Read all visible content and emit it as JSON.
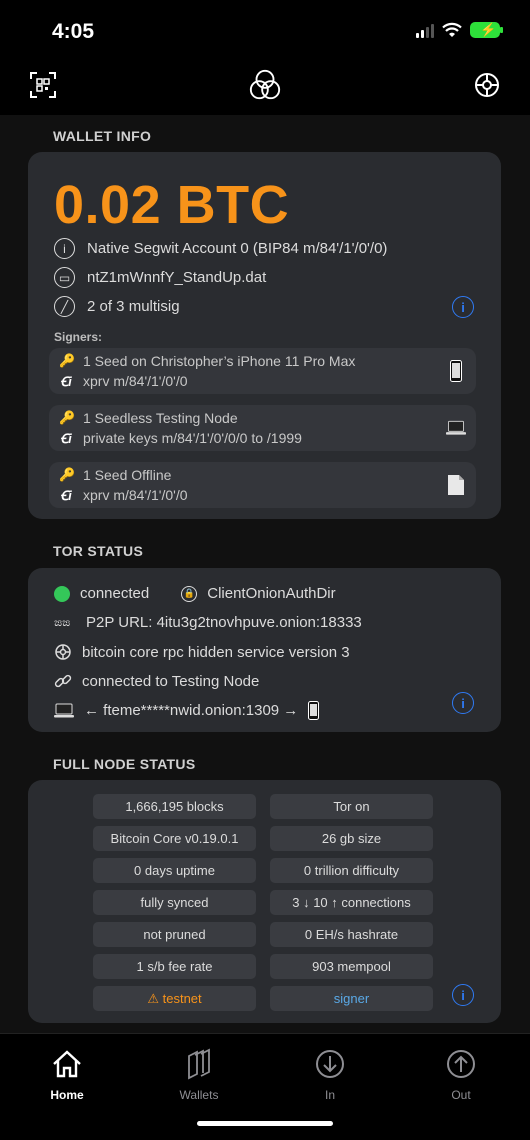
{
  "status_bar": {
    "time": "4:05"
  },
  "wallet_info": {
    "section_title": "WALLET INFO",
    "balance": "0.02 BTC",
    "account": "Native Segwit Account 0 (BIP84 m/84'/1'/0'/0)",
    "filename": "ntZ1mWnnfY_StandUp.dat",
    "multisig": "2 of 3 multisig",
    "signers_label": "Signers:",
    "signers": [
      {
        "title": "1 Seed on Christopher’s iPhone 11 Pro Max",
        "detail": "xprv m/84'/1'/0'/0",
        "device": "phone-icon"
      },
      {
        "title": "1 Seedless Testing Node",
        "detail": "private keys m/84'/1'/0'/0/0 to /1999",
        "device": "laptop-icon"
      },
      {
        "title": "1 Seed Offline",
        "detail": "xprv m/84'/1'/0'/0",
        "device": "document-icon"
      }
    ]
  },
  "tor_status": {
    "section_title": "TOR STATUS",
    "connection": "connected",
    "auth_dir": "ClientOnionAuthDir",
    "p2p_url": "P2P URL: 4itu3g2tnovhpuve.onion:18333",
    "rpc_service": "bitcoin core rpc hidden service version 3",
    "connected_to": "connected to Testing Node",
    "route": "← fteme*****nwid.onion:1309 →"
  },
  "full_node_status": {
    "section_title": "FULL NODE STATUS",
    "left": [
      "1,666,195 blocks",
      "Bitcoin Core v0.19.0.1",
      "0 days uptime",
      "fully synced",
      "not pruned",
      "1 s/b fee rate",
      "⚠ testnet"
    ],
    "right": [
      "Tor on",
      "26 gb size",
      "0 trillion difficulty",
      "3 ↓ 10 ↑ connections",
      "0 EH/s hashrate",
      "903 mempool",
      "signer"
    ]
  },
  "tabs": [
    {
      "label": "Home",
      "icon": "home-icon",
      "active": true
    },
    {
      "label": "Wallets",
      "icon": "wallets-icon",
      "active": false
    },
    {
      "label": "In",
      "icon": "arrow-down-circle-icon",
      "active": false
    },
    {
      "label": "Out",
      "icon": "arrow-up-circle-icon",
      "active": false
    }
  ],
  "colors": {
    "bitcoin_orange": "#f7931a",
    "info_blue": "#2f7bf5",
    "connected_green": "#34c759",
    "card": "#2a2c30"
  }
}
